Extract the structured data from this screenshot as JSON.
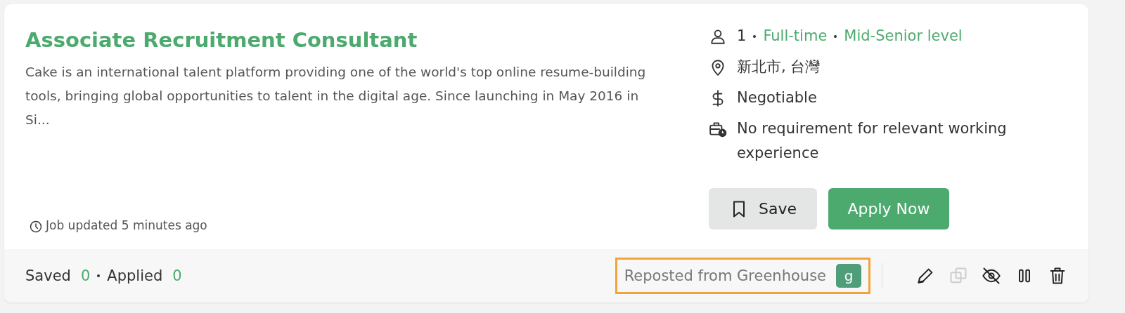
{
  "job": {
    "title": "Associate Recruitment Consultant",
    "description": "Cake is an international talent platform providing one of the world's top online resume-building tools, bringing global opportunities to talent in the digital age. Since launching in May 2016 in Si...",
    "updated": "Job updated 5 minutes ago"
  },
  "details": [
    {
      "kind": "person",
      "parts": [
        "1",
        "Full-time",
        "Mid-Senior level"
      ]
    },
    {
      "kind": "location",
      "parts": [
        "新北市, 台灣"
      ]
    },
    {
      "kind": "salary",
      "parts": [
        "Negotiable"
      ]
    },
    {
      "kind": "experience",
      "parts": [
        "No requirement for relevant working experience"
      ]
    }
  ],
  "buttons": [
    {
      "kind": "save",
      "label": "Save"
    },
    {
      "kind": "apply",
      "label": "Apply Now"
    }
  ],
  "footer": {
    "stats": [
      {
        "label": "Saved",
        "count": "0"
      },
      {
        "label": "Applied",
        "count": "0"
      }
    ],
    "repost": {
      "text": "Reposted from Greenhouse",
      "logo_letter": "g",
      "highlighted": true
    },
    "actions": [
      {
        "kind": "edit",
        "disabled": false
      },
      {
        "kind": "copy",
        "disabled": true
      },
      {
        "kind": "hide",
        "disabled": false
      },
      {
        "kind": "pause",
        "disabled": false
      },
      {
        "kind": "delete",
        "disabled": false
      }
    ]
  }
}
